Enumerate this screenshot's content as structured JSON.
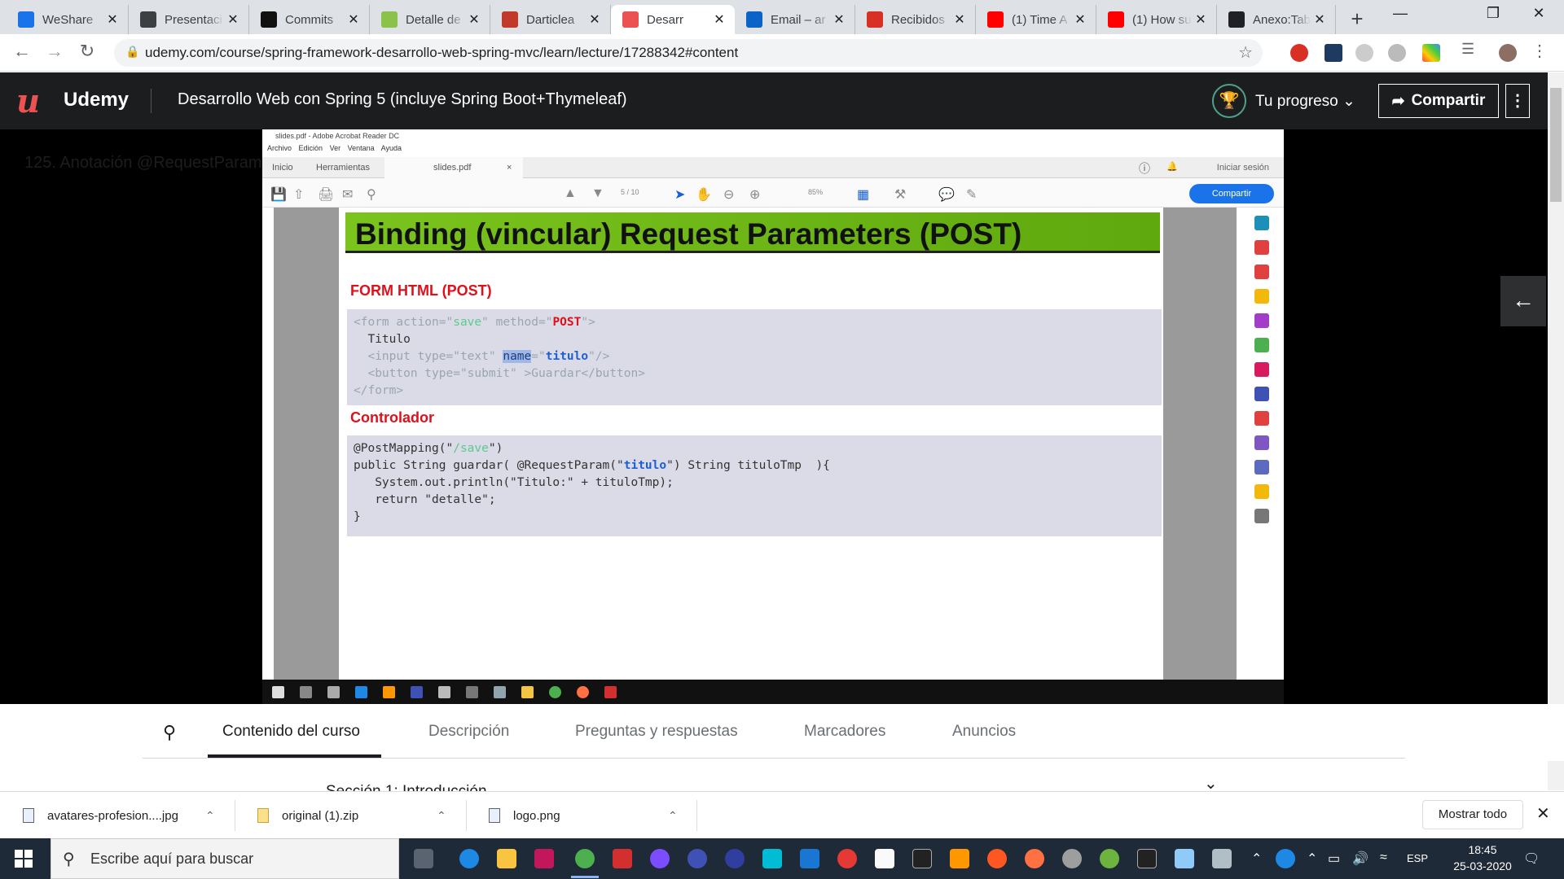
{
  "browser": {
    "tabs": [
      {
        "label": "WeShare",
        "favicon": "weshare-icon",
        "color": "#1a73e8"
      },
      {
        "label": "Presentaci",
        "favicon": "globe-icon",
        "color": "#3c4043"
      },
      {
        "label": "Commits",
        "favicon": "github-icon",
        "color": "#111111"
      },
      {
        "label": "Detalle de",
        "favicon": "leaf-icon",
        "color": "#8bc34a"
      },
      {
        "label": "Darticlea",
        "favicon": "heart-icon",
        "color": "#c0392b"
      },
      {
        "label": "Desarr",
        "favicon": "udemy-icon",
        "color": "#ec5252",
        "active": true
      },
      {
        "label": "Email – ar",
        "favicon": "outlook-icon",
        "color": "#0a64c8"
      },
      {
        "label": "Recibidos",
        "favicon": "gmail-icon",
        "color": "#d93025"
      },
      {
        "label": "(1) Time A",
        "favicon": "youtube-icon",
        "color": "#ff0000"
      },
      {
        "label": "(1) How su",
        "favicon": "youtube-icon",
        "color": "#ff0000"
      },
      {
        "label": "Anexo:Tab",
        "favicon": "wikipedia-icon",
        "color": "#202124"
      }
    ],
    "url": "udemy.com/course/spring-framework-desarrollo-web-spring-mvc/learn/lecture/17288342#content"
  },
  "udemy": {
    "logo_text": "Udemy",
    "course_title": "Desarrollo Web con Spring 5 (incluye Spring Boot+Thymeleaf)",
    "progress_label": "Tu progreso",
    "share_label": "Compartir",
    "lecture_ghost": "125. Anotación @RequestParam"
  },
  "acrobat": {
    "window_title": "slides.pdf - Adobe Acrobat Reader DC",
    "menu": [
      "Archivo",
      "Edición",
      "Ver",
      "Ventana",
      "Ayuda"
    ],
    "tabs": [
      "Inicio",
      "Herramientas",
      "slides.pdf"
    ],
    "signin": "Iniciar sesión",
    "share": "Compartir",
    "page": "5 / 10",
    "zoom": "85%"
  },
  "slide": {
    "title": "Binding (vincular) Request Parameters (POST)",
    "section1": "FORM HTML (POST)",
    "section2": "Controlador"
  },
  "course_tabs": {
    "items": [
      "Contenido del curso",
      "Descripción",
      "Preguntas y respuestas",
      "Marcadores",
      "Anuncios"
    ],
    "section_title": "Sección 1: Introducción"
  },
  "downloads": {
    "items": [
      {
        "name": "avatares-profesion....jpg"
      },
      {
        "name": "original (1).zip"
      },
      {
        "name": "logo.png"
      }
    ],
    "show_all": "Mostrar todo"
  },
  "taskbar": {
    "search_placeholder": "Escribe aquí para buscar",
    "language": "ESP",
    "time": "18:45",
    "date": "25-03-2020"
  }
}
